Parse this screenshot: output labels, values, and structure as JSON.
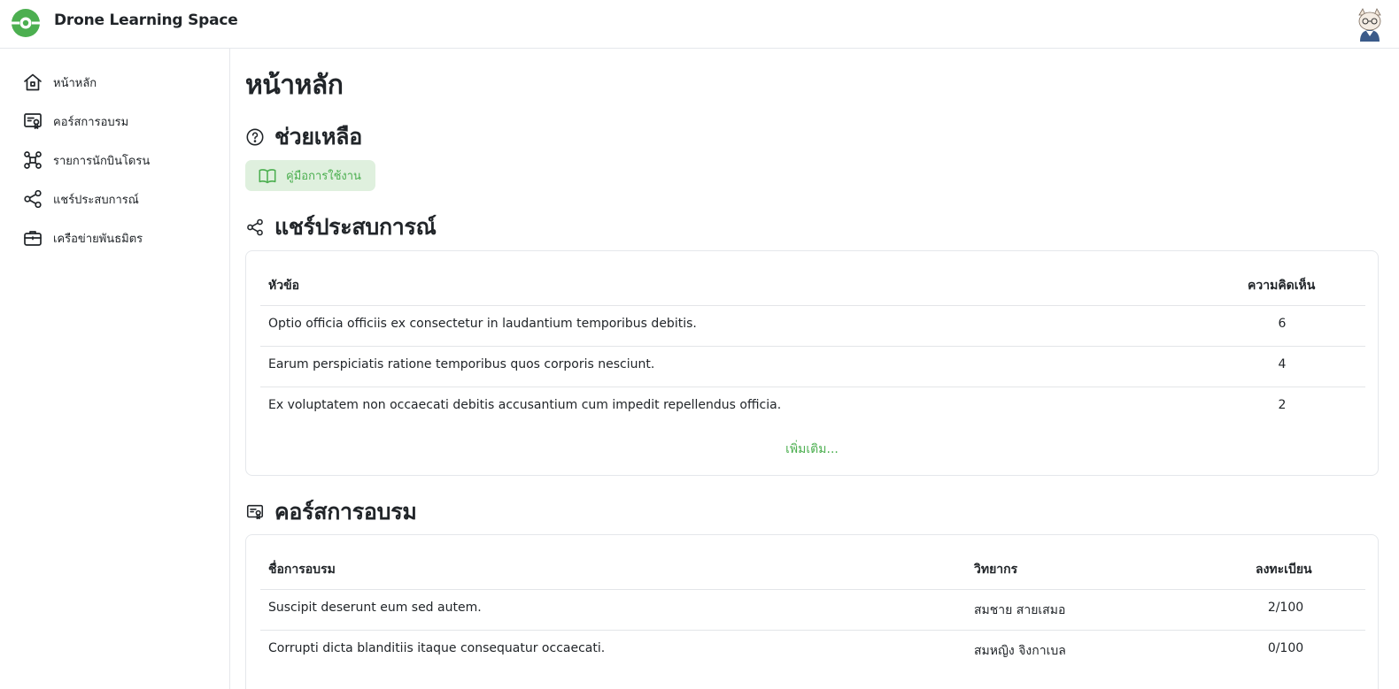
{
  "header": {
    "app_title": "Drone Learning Space",
    "brand_color": "#4caf50"
  },
  "sidebar": {
    "items": [
      {
        "label": "หน้าหลัก",
        "icon": "home-icon"
      },
      {
        "label": "คอร์สการอบรม",
        "icon": "certificate-icon"
      },
      {
        "label": "รายการนักบินโดรน",
        "icon": "drone-icon"
      },
      {
        "label": "แชร์ประสบการณ์",
        "icon": "share-icon"
      },
      {
        "label": "เครือข่ายพันธมิตร",
        "icon": "briefcase-icon"
      }
    ]
  },
  "main": {
    "page_title": "หน้าหลัก",
    "help": {
      "title": "ช่วยเหลือ",
      "icon": "help-circle-icon",
      "manual_button": "คู่มือการใช้งาน",
      "manual_icon": "book-icon"
    },
    "experience": {
      "title": "แชร์ประสบการณ์",
      "icon": "share-icon",
      "columns": [
        "หัวข้อ",
        "ความคิดเห็น"
      ],
      "rows": [
        {
          "topic": "Optio officia officiis ex consectetur in laudantium temporibus debitis.",
          "comments": "6"
        },
        {
          "topic": "Earum perspiciatis ratione temporibus quos corporis nesciunt.",
          "comments": "4"
        },
        {
          "topic": "Ex voluptatem non occaecati debitis accusantium cum impedit repellendus officia.",
          "comments": "2"
        }
      ],
      "more_link": "เพิ่มเติม..."
    },
    "courses": {
      "title": "คอร์สการอบรม",
      "icon": "certificate-icon",
      "columns": [
        "ชื่อการอบรม",
        "วิทยากร",
        "ลงทะเบียน"
      ],
      "rows": [
        {
          "name": "Suscipit deserunt eum sed autem.",
          "speaker": "สมชาย สายเสมอ",
          "registered": "2/100"
        },
        {
          "name": "Corrupti dicta blanditiis itaque consequatur occaecati.",
          "speaker": "สมหญิง จิงกาเบล",
          "registered": "0/100"
        }
      ]
    }
  }
}
